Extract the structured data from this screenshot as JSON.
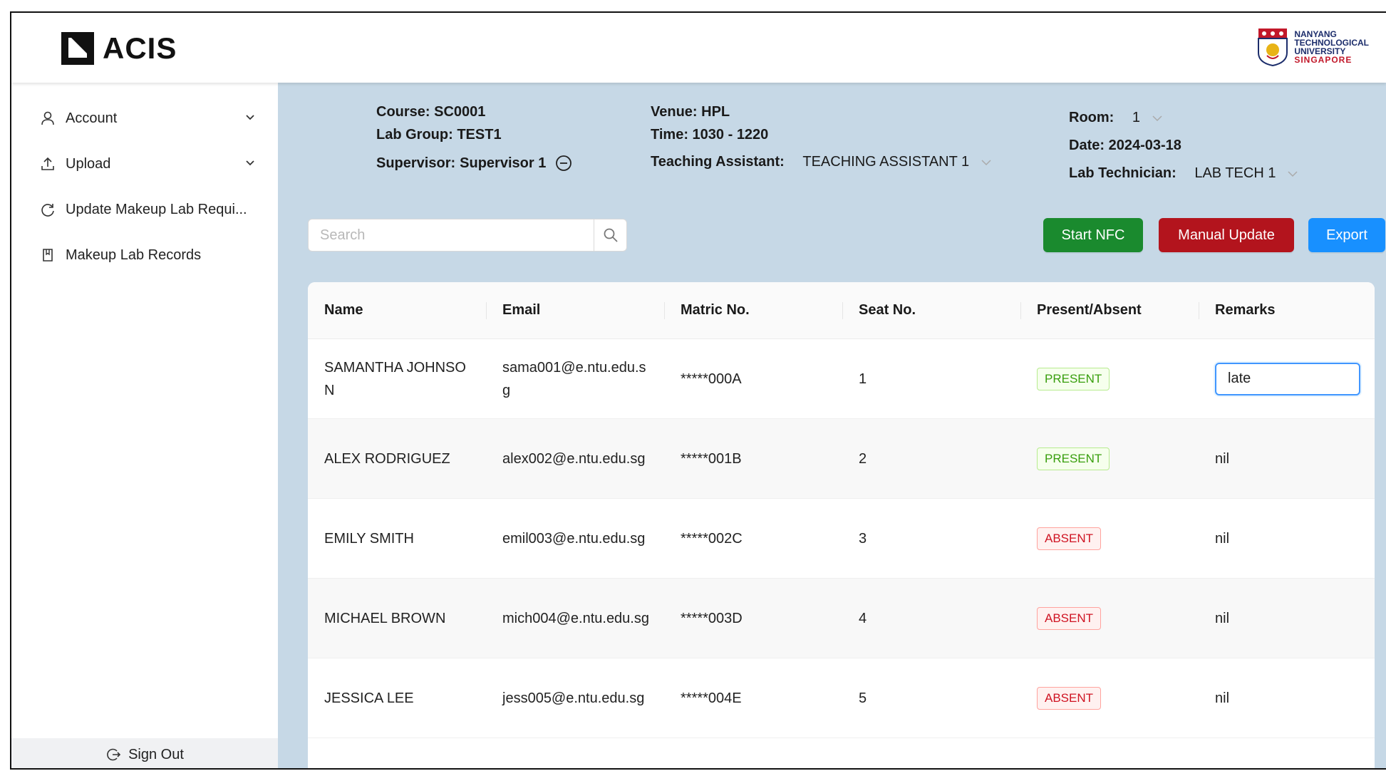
{
  "header": {
    "app_name": "ACIS",
    "university_lines": [
      "NANYANG",
      "TECHNOLOGICAL",
      "UNIVERSITY"
    ],
    "university_country": "SINGAPORE"
  },
  "sidebar": {
    "items": [
      {
        "label": "Account",
        "icon": "user-icon",
        "expandable": true
      },
      {
        "label": "Upload",
        "icon": "upload-icon",
        "expandable": true
      },
      {
        "label": "Update Makeup Lab Requi...",
        "icon": "refresh-icon",
        "expandable": false
      },
      {
        "label": "Makeup Lab Records",
        "icon": "bookmark-icon",
        "expandable": false
      }
    ],
    "sign_out": "Sign Out"
  },
  "session": {
    "course_label": "Course:",
    "course": "SC0001",
    "lab_group_label": "Lab Group:",
    "lab_group": "TEST1",
    "supervisor_label": "Supervisor:",
    "supervisor": "Supervisor 1",
    "venue_label": "Venue:",
    "venue": "HPL",
    "time_label": "Time:",
    "time": "1030 - 1220",
    "ta_label": "Teaching Assistant:",
    "ta": "TEACHING ASSISTANT 1",
    "room_label": "Room:",
    "room": "1",
    "date_label": "Date:",
    "date": "2024-03-18",
    "tech_label": "Lab Technician:",
    "tech": "LAB TECH 1"
  },
  "toolbar": {
    "search_placeholder": "Search",
    "start_nfc": "Start NFC",
    "manual_update": "Manual Update",
    "export": "Export"
  },
  "colors": {
    "green": "#1a8a2e",
    "red": "#b3141d",
    "blue": "#1890ff",
    "main_bg": "#c6d8e6"
  },
  "table": {
    "columns": [
      "Name",
      "Email",
      "Matric No.",
      "Seat No.",
      "Present/Absent",
      "Remarks"
    ],
    "rows": [
      {
        "name": "SAMANTHA JOHNSON",
        "email": "sama001@e.ntu.edu.sg",
        "matric": "*****000A",
        "seat": "1",
        "status": "PRESENT",
        "remarks": "late",
        "editing": true
      },
      {
        "name": "ALEX RODRIGUEZ",
        "email": "alex002@e.ntu.edu.sg",
        "matric": "*****001B",
        "seat": "2",
        "status": "PRESENT",
        "remarks": "nil"
      },
      {
        "name": "EMILY SMITH",
        "email": "emil003@e.ntu.edu.sg",
        "matric": "*****002C",
        "seat": "3",
        "status": "ABSENT",
        "remarks": "nil"
      },
      {
        "name": "MICHAEL BROWN",
        "email": "mich004@e.ntu.edu.sg",
        "matric": "*****003D",
        "seat": "4",
        "status": "ABSENT",
        "remarks": "nil"
      },
      {
        "name": "JESSICA LEE",
        "email": "jess005@e.ntu.edu.sg",
        "matric": "*****004E",
        "seat": "5",
        "status": "ABSENT",
        "remarks": "nil"
      }
    ]
  }
}
